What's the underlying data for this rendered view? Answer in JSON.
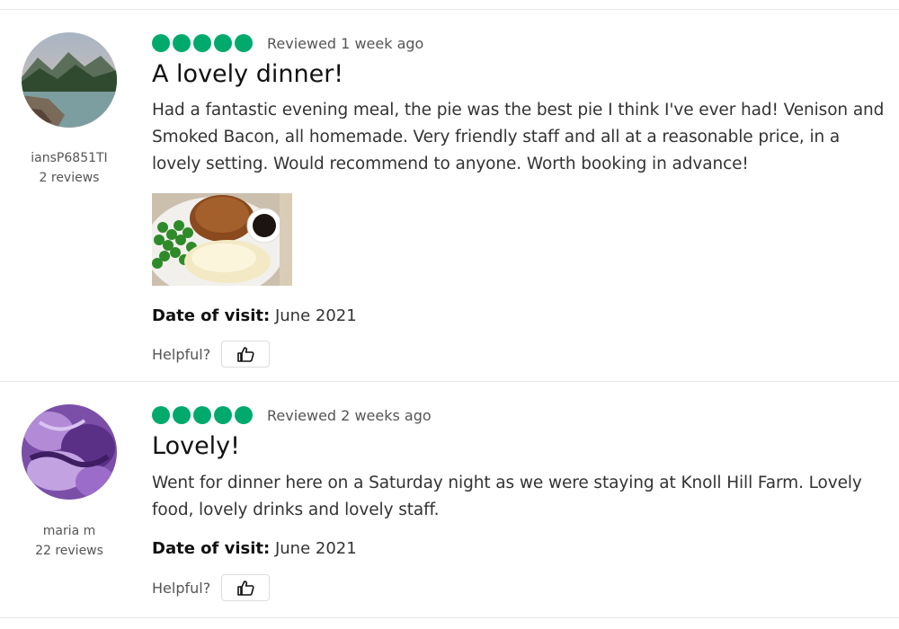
{
  "reviews": [
    {
      "user": {
        "name": "iansP6851TI",
        "review_count": "2 reviews"
      },
      "rating": 5,
      "reviewed": "Reviewed 1 week ago",
      "title": "A lovely dinner!",
      "body": "Had a fantastic evening meal, the pie was the best pie I think I've ever had! Venison and Smoked Bacon, all homemade. Very friendly staff and all at a reasonable price, in a lovely setting. Would recommend to anyone. Worth booking in advance!",
      "date_label": "Date of visit:",
      "date_value": "June 2021",
      "helpful_label": "Helpful?"
    },
    {
      "user": {
        "name": "maria m",
        "review_count": "22 reviews"
      },
      "rating": 5,
      "reviewed": "Reviewed 2 weeks ago",
      "title": "Lovely!",
      "body": "Went for dinner here on a Saturday night as we were staying at Knoll Hill Farm. Lovely food, lovely drinks and lovely staff.",
      "date_label": "Date of visit:",
      "date_value": "June 2021",
      "helpful_label": "Helpful?"
    }
  ],
  "colors": {
    "bubble": "#00aa6c",
    "divider": "#e6e6e6"
  },
  "icons": {
    "helpful": "thumbs-up-icon",
    "rating": "rating-bubble-icon"
  }
}
